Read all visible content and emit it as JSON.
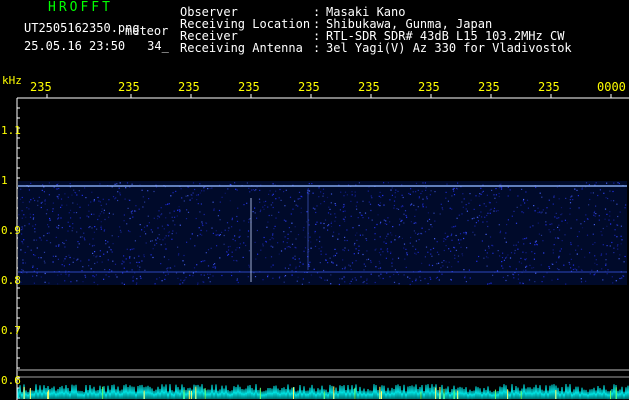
{
  "header": {
    "app_title": "HROFFT",
    "filename": "UT2505162350.png",
    "event_label": "meteor",
    "datetime": "25.05.16 23:50",
    "seconds": "34_"
  },
  "info": [
    {
      "label": "Observer",
      "sep": ":",
      "value": "Masaki Kano"
    },
    {
      "label": "Receiving Location",
      "sep": ":",
      "value": "Shibukawa, Gunma, Japan"
    },
    {
      "label": "Receiver",
      "sep": ":",
      "value": "RTL-SDR SDR# 43dB L15 103.2MHz CW"
    },
    {
      "label": "Receiving Antenna",
      "sep": ":",
      "value": "3el Yagi(V) Az 330 for Vladivostok"
    }
  ],
  "axis": {
    "y_unit": "kHz",
    "x_ticks": [
      "235",
      "235",
      "235",
      "235",
      "235",
      "235",
      "235",
      "235",
      "235",
      "0000"
    ],
    "y_ticks": [
      "1.1",
      "1",
      "0.9",
      "0.8",
      "0.7",
      "0.6"
    ]
  },
  "colors": {
    "background": "#000000",
    "text_info": "#ffffff",
    "text_title": "#00ff00",
    "text_ticks": "#ffff00",
    "spectrum_noise": "#1e2bd0",
    "signal_line": "#9fc6ff",
    "bottom_baseline": "#00ffff"
  }
}
